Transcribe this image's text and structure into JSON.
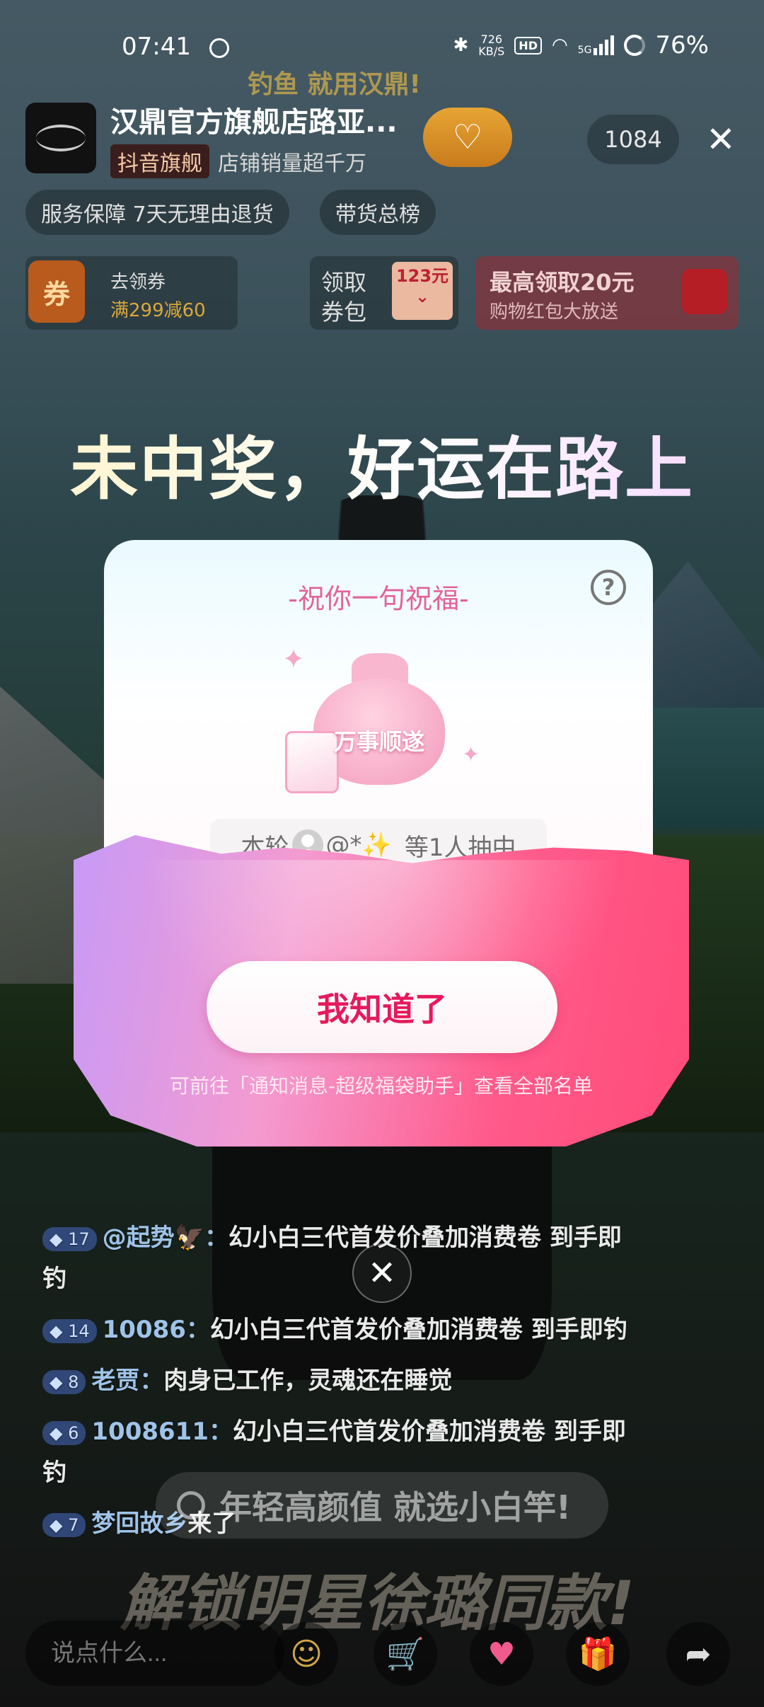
{
  "status_bar": {
    "time": "07:41",
    "net_speed_top": "726",
    "net_speed_bottom": "KB/S",
    "hd": "HD",
    "network": "5G",
    "battery": "76%"
  },
  "header": {
    "shop_name": "汉鼎官方旗舰店路亚...",
    "badge": "抖音旗舰",
    "subtitle": "店铺销量超千万",
    "viewer_count": "1084",
    "brand_banner": "钓鱼 就用汉鼎!"
  },
  "chips": {
    "service": "服务保障 7天无理由退货",
    "ranking": "带货总榜"
  },
  "promos": {
    "coupon_icon": "券",
    "coupon_line1": "去领券",
    "coupon_line2": "满299减60",
    "packet_line1": "领取",
    "packet_line2": "券包",
    "packet_price": "123元",
    "max_line1": "最高领取20元",
    "max_line2": "购物红包大放送"
  },
  "headline": "未中奖，好运在路上",
  "card": {
    "title": "-祝你一句祝福-",
    "help": "?",
    "bag_text": "万事顺遂",
    "winner_prefix": "本轮",
    "winner_name": "@*✨",
    "winner_suffix": "等1人抽中"
  },
  "ok_button": "我知道了",
  "hint": "可前往「通知消息-超级福袋助手」查看全部名单",
  "chat": [
    {
      "level": "17",
      "user": "@起势🦅：",
      "text": "幻小白三代首发价叠加消费卷 到手即钓"
    },
    {
      "level": "14",
      "user": "10086：",
      "text": "幻小白三代首发价叠加消费卷 到手即钓"
    },
    {
      "level": "8",
      "user": "老贾：",
      "text": "肉身已工作，灵魂还在睡觉"
    },
    {
      "level": "6",
      "user": "1008611：",
      "text": "幻小白三代首发价叠加消费卷 到手即钓"
    },
    {
      "level": "7",
      "user": "梦回故乡",
      "text": "来了"
    }
  ],
  "search_banner": "年轻高颜值 就选小白竿!",
  "star_banner": "解锁明星徐璐同款!",
  "bottom": {
    "input_placeholder": "说点什么..."
  }
}
